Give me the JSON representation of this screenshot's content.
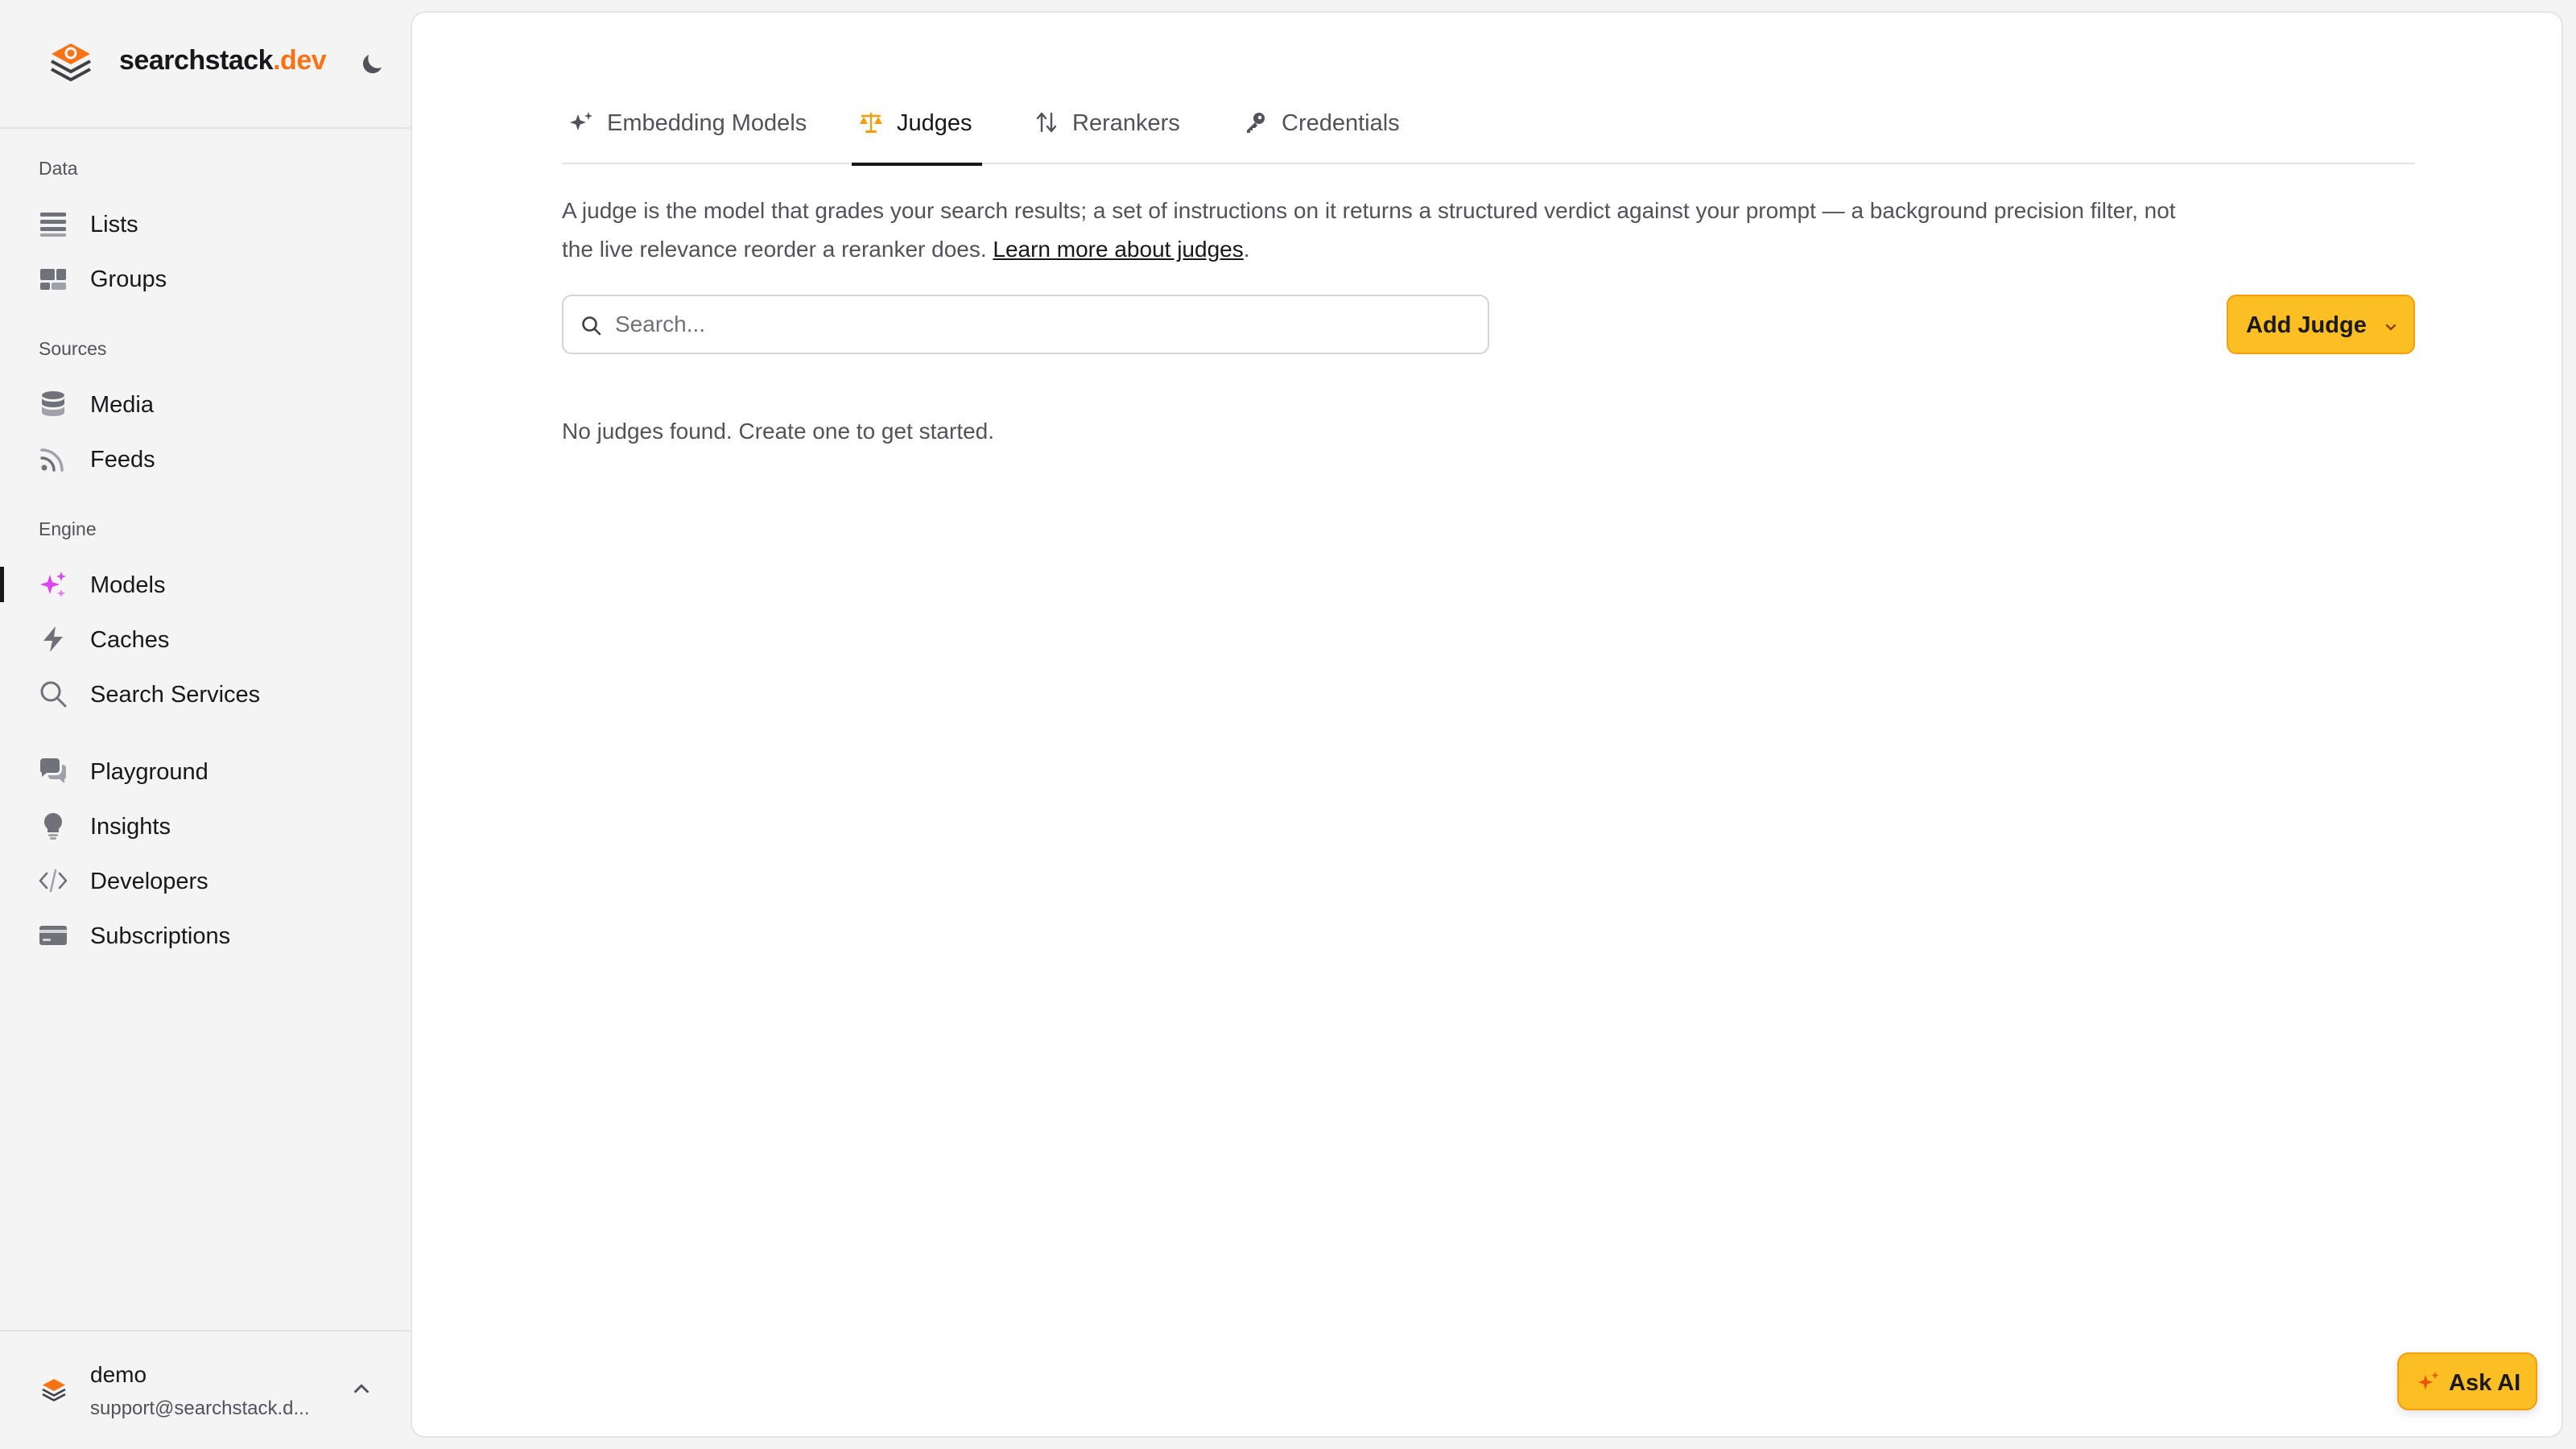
{
  "brand": {
    "name": "searchstack",
    "tld": ".dev",
    "accent": "#f97316"
  },
  "sidebar": {
    "sections": [
      {
        "label": "Data",
        "items": [
          {
            "label": "Lists",
            "icon": "list-icon"
          },
          {
            "label": "Groups",
            "icon": "groups-icon"
          }
        ]
      },
      {
        "label": "Sources",
        "items": [
          {
            "label": "Media",
            "icon": "database-icon"
          },
          {
            "label": "Feeds",
            "icon": "rss-icon"
          }
        ]
      },
      {
        "label": "Engine",
        "items": [
          {
            "label": "Models",
            "icon": "sparkles-icon",
            "active": true
          },
          {
            "label": "Caches",
            "icon": "bolt-icon"
          },
          {
            "label": "Search Services",
            "icon": "search-icon"
          }
        ]
      },
      {
        "label": "",
        "items": [
          {
            "label": "Playground",
            "icon": "chat-bubbles-icon"
          },
          {
            "label": "Insights",
            "icon": "lightbulb-icon"
          },
          {
            "label": "Developers",
            "icon": "code-icon"
          },
          {
            "label": "Subscriptions",
            "icon": "credit-card-icon"
          }
        ]
      }
    ]
  },
  "user": {
    "name": "demo",
    "email": "support@searchstack.d..."
  },
  "tabs": [
    {
      "label": "Embedding Models",
      "icon": "sparkles-icon"
    },
    {
      "label": "Judges",
      "icon": "scale-icon",
      "active": true
    },
    {
      "label": "Rerankers",
      "icon": "arrows-up-down-icon"
    },
    {
      "label": "Credentials",
      "icon": "key-icon"
    }
  ],
  "description": {
    "text": "A judge is the model that grades your search results; a set of instructions on it returns a structured verdict against your prompt — a background precision filter, not the live relevance reorder a reranker does. ",
    "link": "Learn more about judges",
    "suffix": "."
  },
  "search": {
    "placeholder": "Search...",
    "value": ""
  },
  "add_button": {
    "label": "Add Judge"
  },
  "empty_state": "No judges found. Create one to get started.",
  "ask_ai": {
    "label": "Ask AI"
  },
  "colors": {
    "accent_button": "#fbbf24",
    "active_icon": "#d946ef",
    "tab_active_icon": "#f59e0b"
  }
}
